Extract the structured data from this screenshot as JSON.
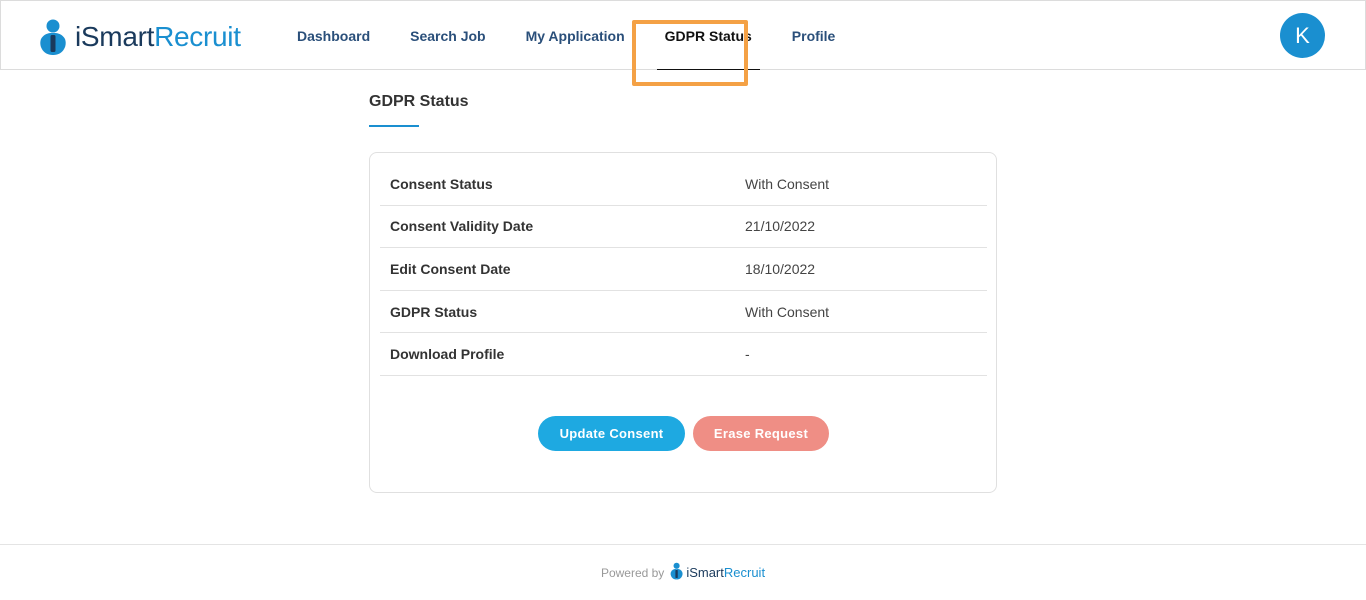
{
  "brand": {
    "name_i": "i",
    "name_smart": "Smart",
    "name_recruit": "Recruit",
    "primary_color": "#1a8fd0",
    "dark_color": "#1a3a5c"
  },
  "nav": {
    "items": [
      {
        "label": "Dashboard"
      },
      {
        "label": "Search Job"
      },
      {
        "label": "My Application"
      },
      {
        "label": "GDPR Status",
        "active": true
      },
      {
        "label": "Profile"
      }
    ]
  },
  "user": {
    "avatar_letter": "K"
  },
  "page": {
    "title": "GDPR Status"
  },
  "gdpr": {
    "rows": [
      {
        "label": "Consent Status",
        "value": "With Consent"
      },
      {
        "label": "Consent Validity Date",
        "value": "21/10/2022"
      },
      {
        "label": "Edit Consent Date",
        "value": "18/10/2022"
      },
      {
        "label": "GDPR Status",
        "value": "With Consent"
      },
      {
        "label": "Download Profile",
        "value": "-"
      }
    ],
    "update_button": "Update Consent",
    "erase_button": "Erase Request"
  },
  "footer": {
    "powered_by": "Powered by",
    "brand_i": "i",
    "brand_smart": "Smart",
    "brand_recruit": "Recruit"
  },
  "highlight_color": "#f4a145"
}
